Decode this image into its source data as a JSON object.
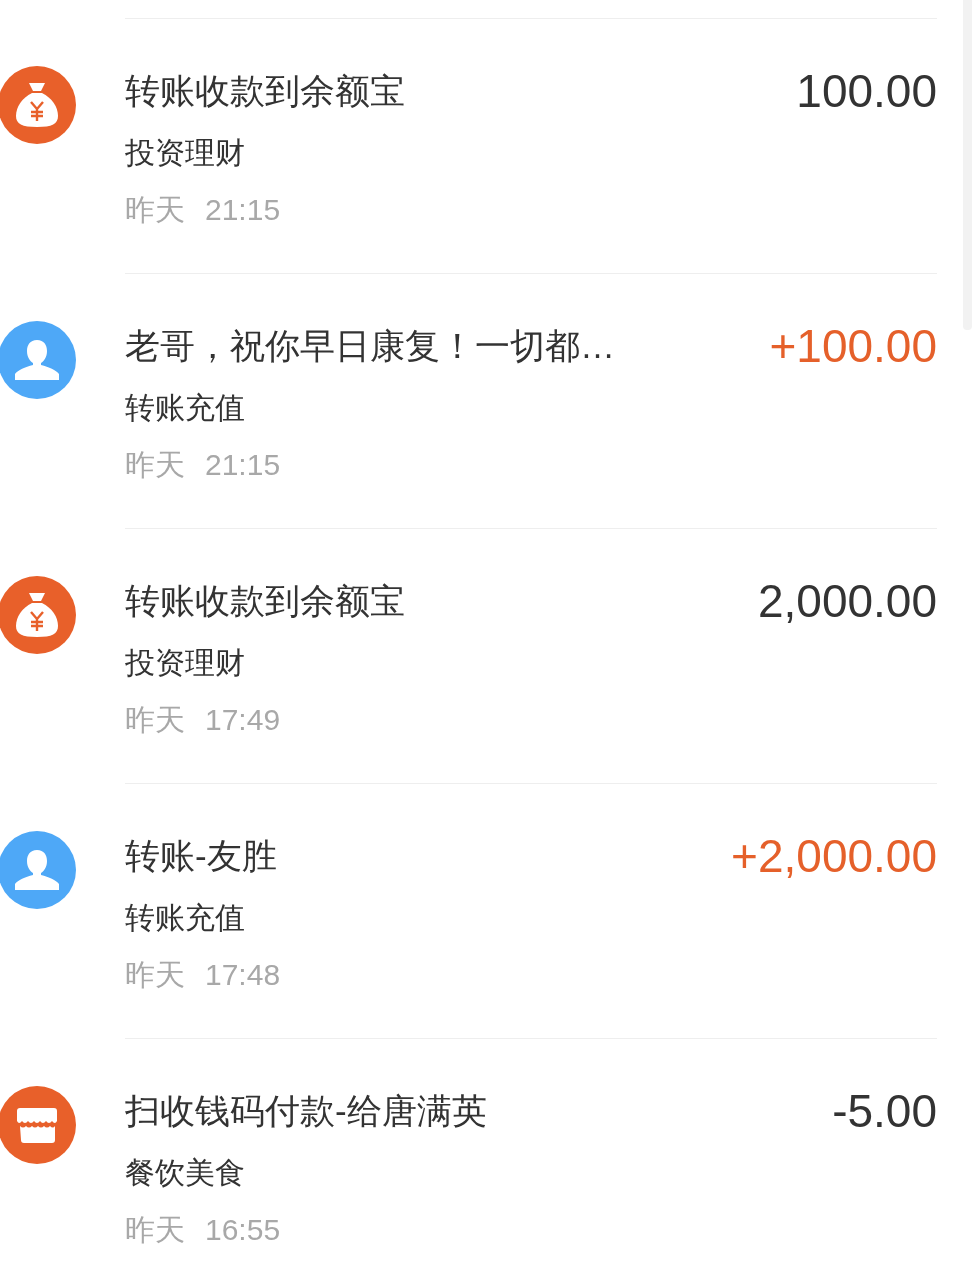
{
  "transactions": [
    {
      "kind": "moneybag",
      "title": "转账收款到余额宝",
      "category": "投资理财",
      "day": "昨天",
      "time": "21:15",
      "amount": "100.00",
      "highlighted": false
    },
    {
      "kind": "person",
      "title": "老哥，祝你早日康复！一切都…",
      "category": "转账充值",
      "day": "昨天",
      "time": "21:15",
      "amount": "+100.00",
      "highlighted": true
    },
    {
      "kind": "moneybag",
      "title": "转账收款到余额宝",
      "category": "投资理财",
      "day": "昨天",
      "time": "17:49",
      "amount": "2,000.00",
      "highlighted": false
    },
    {
      "kind": "person",
      "title": "转账-友胜",
      "category": "转账充值",
      "day": "昨天",
      "time": "17:48",
      "amount": "+2,000.00",
      "highlighted": true
    },
    {
      "kind": "shop",
      "title": "扫收钱码付款-给唐满英",
      "category": "餐饮美食",
      "day": "昨天",
      "time": "16:55",
      "amount": "-5.00",
      "highlighted": false
    }
  ]
}
